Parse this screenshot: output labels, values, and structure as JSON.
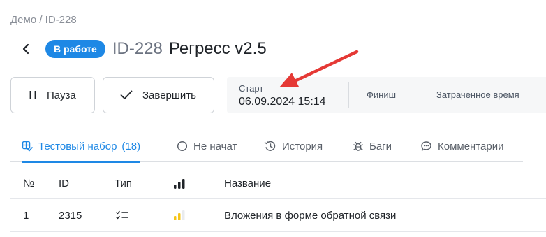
{
  "breadcrumb": "Демо / ID-228",
  "header": {
    "status": "В работе",
    "id": "ID-228",
    "name": "Регресс v2.5"
  },
  "actions": {
    "pause_label": "Пауза",
    "finish_label": "Завершить"
  },
  "times": {
    "start_label": "Старт",
    "start_value": "06.09.2024 15:14",
    "finish_label": "Финиш",
    "spent_label": "Затраченное время"
  },
  "tabs": [
    {
      "label": "Тестовый набор",
      "count": "(18)",
      "icon": "test-suite-icon",
      "active": true
    },
    {
      "label": "Не начат",
      "icon": "circle-icon"
    },
    {
      "label": "История",
      "icon": "history-icon"
    },
    {
      "label": "Баги",
      "icon": "bug-icon"
    },
    {
      "label": "Комментарии",
      "icon": "comment-icon"
    }
  ],
  "table": {
    "columns": [
      "№",
      "ID",
      "Тип",
      "priority-icon",
      "Название"
    ],
    "rows": [
      {
        "num": "1",
        "id": "2315",
        "type_icon": "checklist-icon",
        "priority_icon": "priority-medium-icon",
        "name": "Вложения в форме обратной связи"
      }
    ]
  },
  "colors": {
    "accent": "#1e88e5",
    "annotation_arrow": "#e53935",
    "priority_medium": "#f5c518"
  }
}
